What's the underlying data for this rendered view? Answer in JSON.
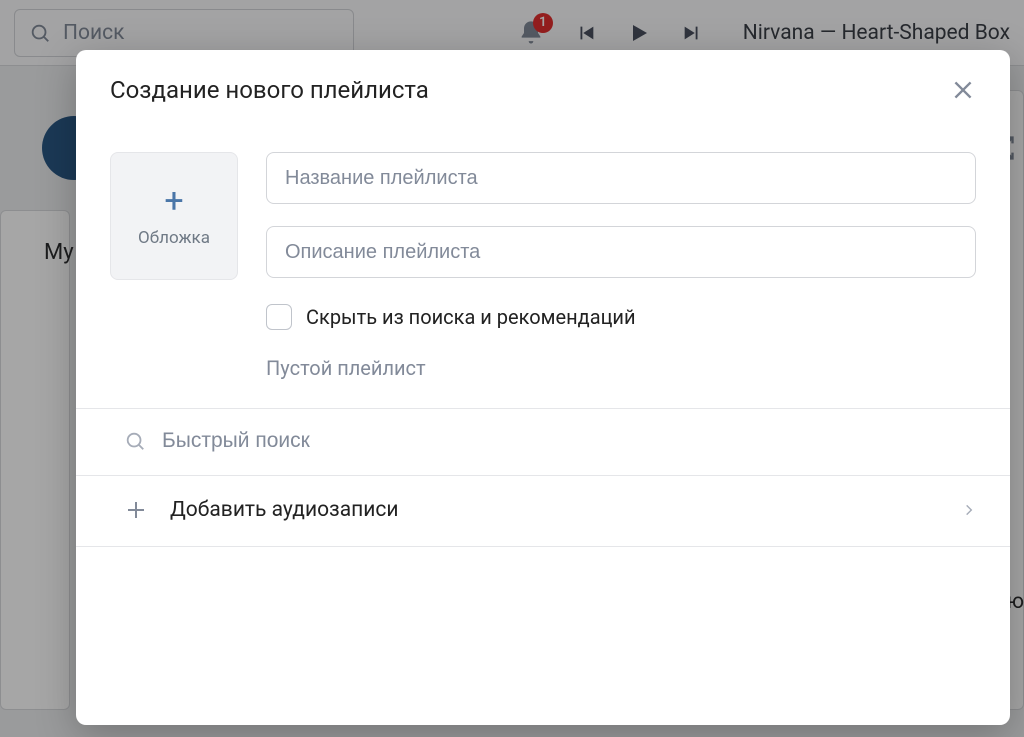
{
  "header": {
    "search_placeholder": "Поиск",
    "badge_count": "1",
    "now_playing": "Nirvana — Heart-Shaped Box"
  },
  "background": {
    "left_text": "Му",
    "right_text": "ению"
  },
  "modal": {
    "title": "Создание нового плейлиста",
    "cover_label": "Обложка",
    "name_placeholder": "Название плейлиста",
    "desc_placeholder": "Описание плейлиста",
    "hide_label": "Скрыть из поиска и рекомендаций",
    "empty_text": "Пустой плейлист",
    "quick_search_placeholder": "Быстрый поиск",
    "add_audio_label": "Добавить аудиозаписи"
  }
}
